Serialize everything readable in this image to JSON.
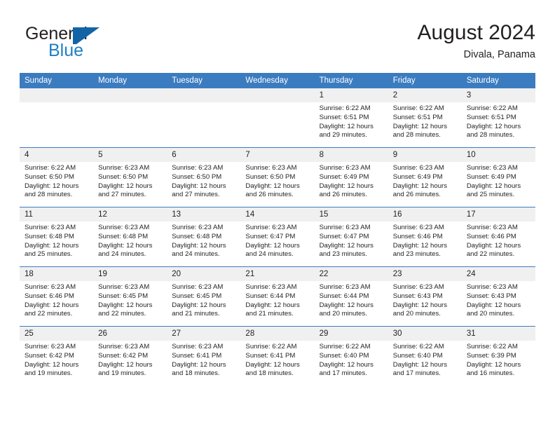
{
  "brand": {
    "word_one": "General",
    "word_two": "Blue",
    "mark": "triangle-flag-logo",
    "colors": {
      "dark": "#231f20",
      "blue": "#1f7fc4",
      "mark": "#1364a6"
    }
  },
  "header": {
    "title": "August 2024",
    "subtitle": "Divala, Panama"
  },
  "theme": {
    "header_blue": "#3b7cc0",
    "daynum_gray": "#f0f0f0",
    "text": "#231f20",
    "cell_bg": "#ffffff"
  },
  "weekday_headers": [
    "Sunday",
    "Monday",
    "Tuesday",
    "Wednesday",
    "Thursday",
    "Friday",
    "Saturday"
  ],
  "labels": {
    "sunrise_prefix": "Sunrise:",
    "sunset_prefix": "Sunset:",
    "daylight_prefix": "Daylight:"
  },
  "weeks": [
    [
      {
        "day": "",
        "blank": true
      },
      {
        "day": "",
        "blank": true
      },
      {
        "day": "",
        "blank": true
      },
      {
        "day": "",
        "blank": true
      },
      {
        "day": "1",
        "sunrise": "Sunrise: 6:22 AM",
        "sunset": "Sunset: 6:51 PM",
        "daylight_line1": "Daylight: 12 hours",
        "daylight_line2": "and 29 minutes."
      },
      {
        "day": "2",
        "sunrise": "Sunrise: 6:22 AM",
        "sunset": "Sunset: 6:51 PM",
        "daylight_line1": "Daylight: 12 hours",
        "daylight_line2": "and 28 minutes."
      },
      {
        "day": "3",
        "sunrise": "Sunrise: 6:22 AM",
        "sunset": "Sunset: 6:51 PM",
        "daylight_line1": "Daylight: 12 hours",
        "daylight_line2": "and 28 minutes."
      }
    ],
    [
      {
        "day": "4",
        "sunrise": "Sunrise: 6:22 AM",
        "sunset": "Sunset: 6:50 PM",
        "daylight_line1": "Daylight: 12 hours",
        "daylight_line2": "and 28 minutes."
      },
      {
        "day": "5",
        "sunrise": "Sunrise: 6:23 AM",
        "sunset": "Sunset: 6:50 PM",
        "daylight_line1": "Daylight: 12 hours",
        "daylight_line2": "and 27 minutes."
      },
      {
        "day": "6",
        "sunrise": "Sunrise: 6:23 AM",
        "sunset": "Sunset: 6:50 PM",
        "daylight_line1": "Daylight: 12 hours",
        "daylight_line2": "and 27 minutes."
      },
      {
        "day": "7",
        "sunrise": "Sunrise: 6:23 AM",
        "sunset": "Sunset: 6:50 PM",
        "daylight_line1": "Daylight: 12 hours",
        "daylight_line2": "and 26 minutes."
      },
      {
        "day": "8",
        "sunrise": "Sunrise: 6:23 AM",
        "sunset": "Sunset: 6:49 PM",
        "daylight_line1": "Daylight: 12 hours",
        "daylight_line2": "and 26 minutes."
      },
      {
        "day": "9",
        "sunrise": "Sunrise: 6:23 AM",
        "sunset": "Sunset: 6:49 PM",
        "daylight_line1": "Daylight: 12 hours",
        "daylight_line2": "and 26 minutes."
      },
      {
        "day": "10",
        "sunrise": "Sunrise: 6:23 AM",
        "sunset": "Sunset: 6:49 PM",
        "daylight_line1": "Daylight: 12 hours",
        "daylight_line2": "and 25 minutes."
      }
    ],
    [
      {
        "day": "11",
        "sunrise": "Sunrise: 6:23 AM",
        "sunset": "Sunset: 6:48 PM",
        "daylight_line1": "Daylight: 12 hours",
        "daylight_line2": "and 25 minutes."
      },
      {
        "day": "12",
        "sunrise": "Sunrise: 6:23 AM",
        "sunset": "Sunset: 6:48 PM",
        "daylight_line1": "Daylight: 12 hours",
        "daylight_line2": "and 24 minutes."
      },
      {
        "day": "13",
        "sunrise": "Sunrise: 6:23 AM",
        "sunset": "Sunset: 6:48 PM",
        "daylight_line1": "Daylight: 12 hours",
        "daylight_line2": "and 24 minutes."
      },
      {
        "day": "14",
        "sunrise": "Sunrise: 6:23 AM",
        "sunset": "Sunset: 6:47 PM",
        "daylight_line1": "Daylight: 12 hours",
        "daylight_line2": "and 24 minutes."
      },
      {
        "day": "15",
        "sunrise": "Sunrise: 6:23 AM",
        "sunset": "Sunset: 6:47 PM",
        "daylight_line1": "Daylight: 12 hours",
        "daylight_line2": "and 23 minutes."
      },
      {
        "day": "16",
        "sunrise": "Sunrise: 6:23 AM",
        "sunset": "Sunset: 6:46 PM",
        "daylight_line1": "Daylight: 12 hours",
        "daylight_line2": "and 23 minutes."
      },
      {
        "day": "17",
        "sunrise": "Sunrise: 6:23 AM",
        "sunset": "Sunset: 6:46 PM",
        "daylight_line1": "Daylight: 12 hours",
        "daylight_line2": "and 22 minutes."
      }
    ],
    [
      {
        "day": "18",
        "sunrise": "Sunrise: 6:23 AM",
        "sunset": "Sunset: 6:46 PM",
        "daylight_line1": "Daylight: 12 hours",
        "daylight_line2": "and 22 minutes."
      },
      {
        "day": "19",
        "sunrise": "Sunrise: 6:23 AM",
        "sunset": "Sunset: 6:45 PM",
        "daylight_line1": "Daylight: 12 hours",
        "daylight_line2": "and 22 minutes."
      },
      {
        "day": "20",
        "sunrise": "Sunrise: 6:23 AM",
        "sunset": "Sunset: 6:45 PM",
        "daylight_line1": "Daylight: 12 hours",
        "daylight_line2": "and 21 minutes."
      },
      {
        "day": "21",
        "sunrise": "Sunrise: 6:23 AM",
        "sunset": "Sunset: 6:44 PM",
        "daylight_line1": "Daylight: 12 hours",
        "daylight_line2": "and 21 minutes."
      },
      {
        "day": "22",
        "sunrise": "Sunrise: 6:23 AM",
        "sunset": "Sunset: 6:44 PM",
        "daylight_line1": "Daylight: 12 hours",
        "daylight_line2": "and 20 minutes."
      },
      {
        "day": "23",
        "sunrise": "Sunrise: 6:23 AM",
        "sunset": "Sunset: 6:43 PM",
        "daylight_line1": "Daylight: 12 hours",
        "daylight_line2": "and 20 minutes."
      },
      {
        "day": "24",
        "sunrise": "Sunrise: 6:23 AM",
        "sunset": "Sunset: 6:43 PM",
        "daylight_line1": "Daylight: 12 hours",
        "daylight_line2": "and 20 minutes."
      }
    ],
    [
      {
        "day": "25",
        "sunrise": "Sunrise: 6:23 AM",
        "sunset": "Sunset: 6:42 PM",
        "daylight_line1": "Daylight: 12 hours",
        "daylight_line2": "and 19 minutes."
      },
      {
        "day": "26",
        "sunrise": "Sunrise: 6:23 AM",
        "sunset": "Sunset: 6:42 PM",
        "daylight_line1": "Daylight: 12 hours",
        "daylight_line2": "and 19 minutes."
      },
      {
        "day": "27",
        "sunrise": "Sunrise: 6:23 AM",
        "sunset": "Sunset: 6:41 PM",
        "daylight_line1": "Daylight: 12 hours",
        "daylight_line2": "and 18 minutes."
      },
      {
        "day": "28",
        "sunrise": "Sunrise: 6:22 AM",
        "sunset": "Sunset: 6:41 PM",
        "daylight_line1": "Daylight: 12 hours",
        "daylight_line2": "and 18 minutes."
      },
      {
        "day": "29",
        "sunrise": "Sunrise: 6:22 AM",
        "sunset": "Sunset: 6:40 PM",
        "daylight_line1": "Daylight: 12 hours",
        "daylight_line2": "and 17 minutes."
      },
      {
        "day": "30",
        "sunrise": "Sunrise: 6:22 AM",
        "sunset": "Sunset: 6:40 PM",
        "daylight_line1": "Daylight: 12 hours",
        "daylight_line2": "and 17 minutes."
      },
      {
        "day": "31",
        "sunrise": "Sunrise: 6:22 AM",
        "sunset": "Sunset: 6:39 PM",
        "daylight_line1": "Daylight: 12 hours",
        "daylight_line2": "and 16 minutes."
      }
    ]
  ]
}
